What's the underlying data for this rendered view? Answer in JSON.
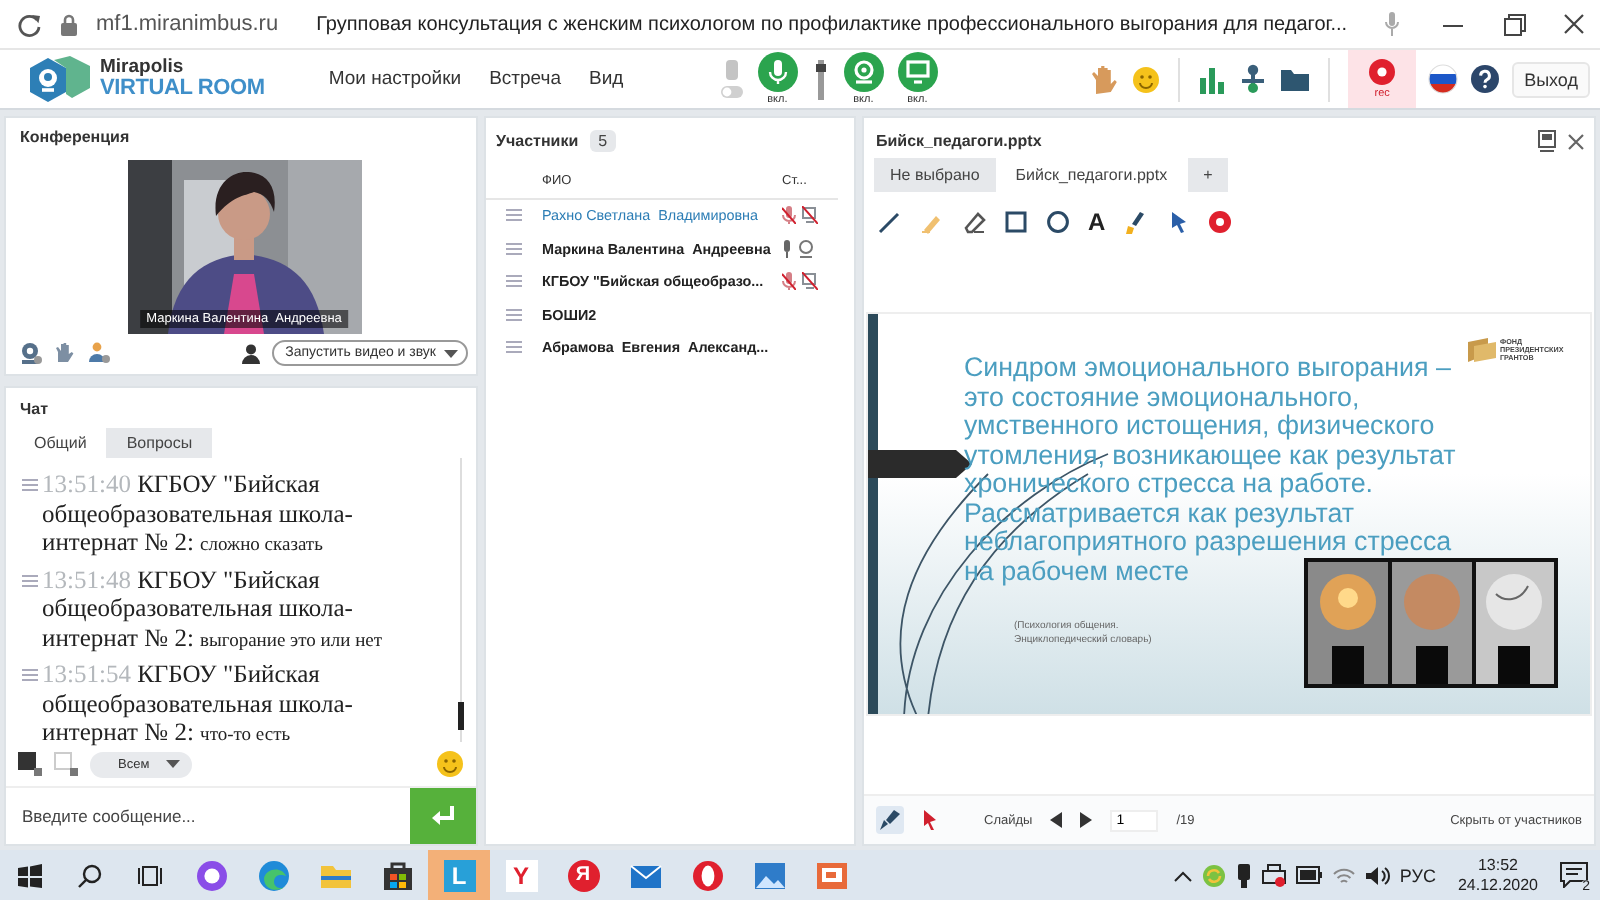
{
  "browser": {
    "url": "mf1.miranimbus.ru",
    "title": "Групповая консультация с женским психологом по профилактике профессионального выгорания для педагог..."
  },
  "header": {
    "logo_top": "Mirapolis",
    "logo_bottom": "VIRTUAL ROOM",
    "menu": [
      "Мои настройки",
      "Встреча",
      "Вид"
    ],
    "volume": {
      "level": 0.85
    },
    "media": [
      {
        "kind": "mic",
        "label": "вкл.",
        "on": true
      },
      {
        "kind": "camera",
        "label": "вкл.",
        "on": true
      },
      {
        "kind": "screen",
        "label": "вкл.",
        "on": true
      }
    ],
    "record": {
      "label": "rec",
      "on": true
    },
    "exit": "Выход"
  },
  "conference": {
    "title": "Конференция",
    "video_caption": "Маркина Валентина  Андреевна",
    "start_button": "Запустить видео и звук"
  },
  "chat": {
    "title": "Чат",
    "tabs": [
      {
        "label": "Общий",
        "selected": true
      },
      {
        "label": "Вопросы",
        "selected": false
      }
    ],
    "messages": [
      {
        "time": "13:51:40",
        "sender": "КГБОУ \"Бийская общеобразовательная школа-интернат № 2:",
        "text": "сложно сказать"
      },
      {
        "time": "13:51:48",
        "sender": "КГБОУ \"Бийская общеобразовательная школа-интернат № 2:",
        "text": "выгорание это или нет"
      },
      {
        "time": "13:51:54",
        "sender": "КГБОУ \"Бийская общеобразовательная школа-интернат № 2:",
        "text": "что-то есть"
      }
    ],
    "recipient": "Всем",
    "placeholder": "Введите сообщение..."
  },
  "participants": {
    "title": "Участники",
    "count": "5",
    "columns": [
      "ФИО",
      "Ст..."
    ],
    "rows": [
      {
        "name": "Рахно Светлана  Владимировна",
        "highlighted": true,
        "has_devices": true,
        "muted": true
      },
      {
        "name": "Маркина Валентина  Андреевна",
        "highlighted": false,
        "has_devices": true,
        "muted": false
      },
      {
        "name": "КГБОУ \"Бийская общеобразо...",
        "highlighted": false,
        "has_devices": true,
        "muted": true
      },
      {
        "name": "БОШИ2",
        "highlighted": false,
        "has_devices": false
      },
      {
        "name": "Абрамова  Евгения  Александ...",
        "highlighted": false,
        "has_devices": false
      }
    ]
  },
  "presentation": {
    "title": "Бийск_педагоги.pptx",
    "tabs": [
      {
        "label": "Не выбрано",
        "selected": false
      },
      {
        "label": "Бийск_педагоги.pptx",
        "selected": true
      }
    ],
    "add_tab": "+",
    "tools": [
      {
        "kind": "pen"
      },
      {
        "kind": "highlighter"
      },
      {
        "kind": "eraser"
      },
      {
        "kind": "rectangle"
      },
      {
        "kind": "ellipse"
      },
      {
        "kind": "text",
        "glyph": "A"
      },
      {
        "kind": "fill"
      },
      {
        "kind": "pointer"
      },
      {
        "kind": "clear"
      }
    ],
    "slide": {
      "heading": "Синдром эмоционального выгорания – это состояние эмоционального, умственного истощения, физического утомления, возникающее как результат хронического стресса на работе. Рассматривается как результат неблагоприятного разрешения стресса на рабочем месте",
      "logo_text": "ФОНД ПРЕЗИДЕНТСКИХ ГРАНТОВ",
      "citation": "(Психология общения. Энциклопедический словарь)"
    },
    "footer": {
      "slides_label": "Слайды",
      "page": "1",
      "total": "/19",
      "hide_button": "Скрыть от участников"
    }
  },
  "taskbar": {
    "apps": [
      {
        "kind": "alice",
        "selected": false
      },
      {
        "kind": "edge",
        "selected": false
      },
      {
        "kind": "explorer",
        "selected": false
      },
      {
        "kind": "store",
        "selected": false
      },
      {
        "kind": "letter-tile",
        "glyph": "L",
        "selected": true
      },
      {
        "kind": "letter-plain",
        "glyph": "Y",
        "selected": false
      },
      {
        "kind": "letter-round",
        "glyph": "Я",
        "selected": false
      },
      {
        "kind": "mail",
        "selected": false
      },
      {
        "kind": "opera",
        "selected": false
      },
      {
        "kind": "photos",
        "selected": false
      },
      {
        "kind": "slides",
        "selected": false
      }
    ],
    "language": "РУС",
    "time": "13:52",
    "date": "24.12.2020",
    "notifications": "2"
  }
}
